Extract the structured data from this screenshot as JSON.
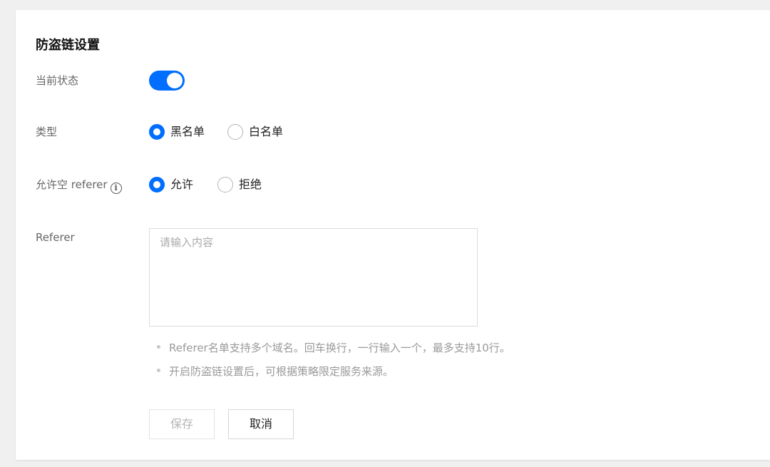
{
  "page": {
    "title": "防盗链设置"
  },
  "status": {
    "label": "当前状态",
    "enabled": true
  },
  "type": {
    "label": "类型",
    "options": [
      {
        "label": "黑名单",
        "checked": true
      },
      {
        "label": "白名单",
        "checked": false
      }
    ]
  },
  "empty_referer": {
    "label": "允许空 referer",
    "info_icon": "i",
    "options": [
      {
        "label": "允许",
        "checked": true
      },
      {
        "label": "拒绝",
        "checked": false
      }
    ]
  },
  "referer": {
    "label": "Referer",
    "placeholder": "请输入内容",
    "value": ""
  },
  "hints": [
    "Referer名单支持多个域名。回车换行，一行输入一个，最多支持10行。",
    "开启防盗链设置后，可根据策略限定服务来源。"
  ],
  "buttons": {
    "save": "保存",
    "cancel": "取消"
  },
  "colors": {
    "accent": "#006eff",
    "disabled_text": "#b5b5b5",
    "hint_text": "#999999"
  },
  "icons": {
    "info": "info-circle-icon",
    "hint_bullet": "bullet-dot-icon"
  }
}
